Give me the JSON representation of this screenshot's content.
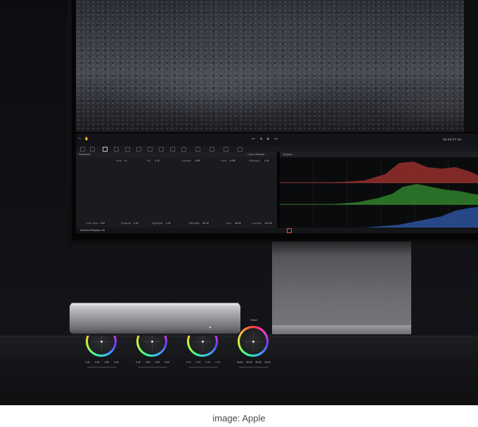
{
  "resolve": {
    "timecode": "00:00:07:16",
    "panels": {
      "primaries": "Primaries",
      "color_wheels": "Color Wheels",
      "scopes": "Scopes"
    },
    "params_top": [
      {
        "label": "Temp",
        "value": "0.0"
      },
      {
        "label": "Tint",
        "value": "0.00"
      },
      {
        "label": "Contrast",
        "value": "1.000"
      },
      {
        "label": "Pivot",
        "value": "0.435"
      },
      {
        "label": "Md/detail",
        "value": "0.00"
      }
    ],
    "wheels": [
      {
        "label": "Lift",
        "values": [
          "0.00",
          "0.00",
          "0.00",
          "0.00"
        ]
      },
      {
        "label": "Gamma",
        "values": [
          "0.00",
          "0.00",
          "0.00",
          "0.00"
        ]
      },
      {
        "label": "Gain",
        "values": [
          "0.74",
          "0.74",
          "0.74",
          "0.74"
        ]
      },
      {
        "label": "Offset",
        "values": [
          "25.00",
          "25.00",
          "25.00",
          "25.00"
        ]
      }
    ],
    "params_bottom": [
      {
        "label": "Color Boost",
        "value": "0.00"
      },
      {
        "label": "Shadows",
        "value": "0.00"
      },
      {
        "label": "Highlights",
        "value": "0.00"
      },
      {
        "label": "Saturation",
        "value": "50.00"
      },
      {
        "label": "Hue",
        "value": "50.00"
      },
      {
        "label": "Lum Mix",
        "value": "100.00"
      }
    ],
    "app_name": "DaVinci Resolve 18",
    "colors": {
      "red": "#c0443e",
      "green": "#3f9a3a",
      "blue": "#3a6fc4"
    }
  },
  "caption": "image: Apple"
}
